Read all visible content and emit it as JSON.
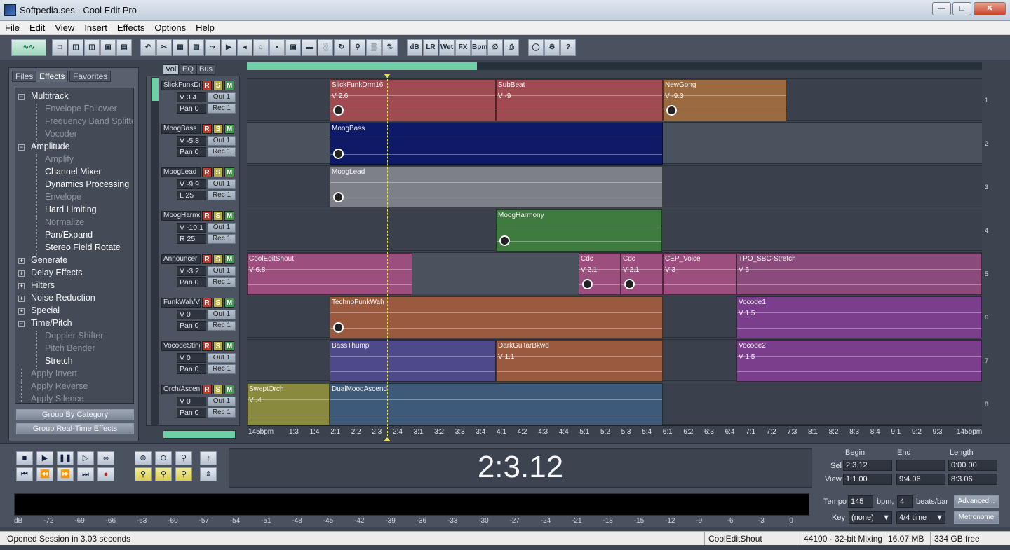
{
  "window": {
    "title": "Softpedia.ses - Cool Edit Pro"
  },
  "menu": [
    "File",
    "Edit",
    "View",
    "Insert",
    "Effects",
    "Options",
    "Help"
  ],
  "left_panel": {
    "tabs": [
      "Files",
      "Effects",
      "Favorites"
    ],
    "active_tab": "Effects",
    "tree": [
      {
        "label": "Multitrack",
        "type": "group",
        "expanded": true
      },
      {
        "label": "Envelope Follower",
        "type": "item",
        "enabled": false
      },
      {
        "label": "Frequency Band Splitter",
        "type": "item",
        "enabled": false
      },
      {
        "label": "Vocoder",
        "type": "item",
        "enabled": false
      },
      {
        "label": "Amplitude",
        "type": "group",
        "expanded": true
      },
      {
        "label": "Amplify",
        "type": "item",
        "enabled": false
      },
      {
        "label": "Channel Mixer",
        "type": "item",
        "enabled": true
      },
      {
        "label": "Dynamics Processing",
        "type": "item",
        "enabled": true
      },
      {
        "label": "Envelope",
        "type": "item",
        "enabled": false
      },
      {
        "label": "Hard Limiting",
        "type": "item",
        "enabled": true
      },
      {
        "label": "Normalize",
        "type": "item",
        "enabled": false
      },
      {
        "label": "Pan/Expand",
        "type": "item",
        "enabled": true
      },
      {
        "label": "Stereo Field Rotate",
        "type": "item",
        "enabled": true
      },
      {
        "label": "Generate",
        "type": "group",
        "expanded": false
      },
      {
        "label": "Delay Effects",
        "type": "group",
        "expanded": false
      },
      {
        "label": "Filters",
        "type": "group",
        "expanded": false
      },
      {
        "label": "Noise Reduction",
        "type": "group",
        "expanded": false
      },
      {
        "label": "Special",
        "type": "group",
        "expanded": false
      },
      {
        "label": "Time/Pitch",
        "type": "group",
        "expanded": true
      },
      {
        "label": "Doppler Shifter",
        "type": "item",
        "enabled": false
      },
      {
        "label": "Pitch Bender",
        "type": "item",
        "enabled": false
      },
      {
        "label": "Stretch",
        "type": "item",
        "enabled": true
      },
      {
        "label": "Apply Invert",
        "type": "root",
        "enabled": false
      },
      {
        "label": "Apply Reverse",
        "type": "root",
        "enabled": false
      },
      {
        "label": "Apply Silence",
        "type": "root",
        "enabled": false
      }
    ],
    "buttons": [
      "Group By Category",
      "Group Real-Time Effects"
    ]
  },
  "track_tabs": [
    "Vol",
    "EQ",
    "Bus"
  ],
  "tracks": [
    {
      "name": "SlickFunkDr",
      "vol": "V 3.4",
      "pan": "Pan 0",
      "out": "Out 1",
      "rec": "Rec 1"
    },
    {
      "name": "MoogBass",
      "vol": "V -5.8",
      "pan": "Pan 0",
      "out": "Out 1",
      "rec": "Rec 1"
    },
    {
      "name": "MoogLead",
      "vol": "V -9.9",
      "pan": "L  25",
      "out": "Out 1",
      "rec": "Rec 1"
    },
    {
      "name": "MoogHarmo",
      "vol": "V -10.1",
      "pan": "R  25",
      "out": "Out 1",
      "rec": "Rec 1"
    },
    {
      "name": "Announcer",
      "vol": "V -3.2",
      "pan": "Pan 0",
      "out": "Out 1",
      "rec": "Rec 1"
    },
    {
      "name": "FunkWah/Vc",
      "vol": "V 0",
      "pan": "Pan 0",
      "out": "Out 1",
      "rec": "Rec 1"
    },
    {
      "name": "VocodeSting",
      "vol": "V 0",
      "pan": "Pan 0",
      "out": "Out 1",
      "rec": "Rec 1"
    },
    {
      "name": "Orch/Ascend",
      "vol": "V 0",
      "pan": "Pan 0",
      "out": "Out 1",
      "rec": "Rec 1"
    }
  ],
  "rsm": [
    "R",
    "S",
    "M"
  ],
  "track_numbers": [
    "1",
    "2",
    "3",
    "4",
    "5",
    "6",
    "7",
    "8"
  ],
  "clips": [
    {
      "lane": 0,
      "name": "SlickFunkDrm16",
      "vol": "V 2.6",
      "color": "#a04a52"
    },
    {
      "lane": 0,
      "name": "SubBeat",
      "vol": "V -9",
      "color": "#a04a52"
    },
    {
      "lane": 0,
      "name": "NewGong",
      "vol": "V -9.3",
      "color": "#9c6a40"
    },
    {
      "lane": 1,
      "name": "MoogBass",
      "vol": "",
      "color": "#0e1a66"
    },
    {
      "lane": 2,
      "name": "MoogLead",
      "vol": "",
      "color": "#7d8088"
    },
    {
      "lane": 3,
      "name": "MoogHarmony",
      "vol": "",
      "color": "#3f7a3e"
    },
    {
      "lane": 4,
      "name": "CoolEditShout",
      "vol": "V 6.8",
      "color": "#9c4f7e"
    },
    {
      "lane": 4,
      "name": "Cdc",
      "vol": "V 2.1",
      "color": "#9c4f7e"
    },
    {
      "lane": 4,
      "name": "Cdc",
      "vol": "V 2.1",
      "color": "#9c4f7e"
    },
    {
      "lane": 4,
      "name": "CEP_Voice",
      "vol": "V 3",
      "color": "#9c4f7e"
    },
    {
      "lane": 4,
      "name": "TPO_SBC-Stretch",
      "vol": "V 6",
      "color": "#8a4a7a"
    },
    {
      "lane": 5,
      "name": "TechnoFunkWah",
      "vol": "",
      "color": "#9a5a40"
    },
    {
      "lane": 5,
      "name": "Vocode1",
      "vol": "V 1.5",
      "color": "#7a3e8c"
    },
    {
      "lane": 6,
      "name": "BassThump",
      "vol": "",
      "color": "#4e4a8a"
    },
    {
      "lane": 6,
      "name": "DarkGuitarBkwd",
      "vol": "V 1.1",
      "color": "#9a5a40"
    },
    {
      "lane": 6,
      "name": "Vocode2",
      "vol": "V 1.5",
      "color": "#7a3e8c"
    },
    {
      "lane": 7,
      "name": "SweptOrch",
      "vol": "V .4",
      "color": "#8a8a3e"
    },
    {
      "lane": 7,
      "name": "DualMoogAscend",
      "vol": "",
      "color": "#3e5a7a"
    }
  ],
  "ruler": [
    "145bpm",
    "1:3",
    "1:4",
    "2:1",
    "2:2",
    "2:3",
    "2:4",
    "3:1",
    "3:2",
    "3:3",
    "3:4",
    "4:1",
    "4:2",
    "4:3",
    "4:4",
    "5:1",
    "5:2",
    "5:3",
    "5:4",
    "6:1",
    "6:2",
    "6:3",
    "6:4",
    "7:1",
    "7:2",
    "7:3",
    "8:1",
    "8:2",
    "8:3",
    "8:4",
    "9:1",
    "9:2",
    "9:3",
    "145bpm"
  ],
  "transport": {
    "time": "2:3.12"
  },
  "selection": {
    "headers": [
      "Begin",
      "End",
      "Length"
    ],
    "sel_label": "Sel",
    "view_label": "View",
    "sel": [
      "2:3.12",
      "",
      "0:00.00"
    ],
    "view": [
      "1:1.00",
      "9:4.06",
      "8:3.06"
    ]
  },
  "meter_scale": [
    "dB",
    "-72",
    "-69",
    "-66",
    "-63",
    "-60",
    "-57",
    "-54",
    "-51",
    "-48",
    "-45",
    "-42",
    "-39",
    "-36",
    "-33",
    "-30",
    "-27",
    "-24",
    "-21",
    "-18",
    "-15",
    "-12",
    "-9",
    "-6",
    "-3",
    "0"
  ],
  "tempo": {
    "tempo_label": "Tempo",
    "tempo": "145",
    "bpm_label": "bpm,",
    "beats": "4",
    "beats_label": "beats/bar",
    "key_label": "Key",
    "key": "(none)",
    "time_sig": "4/4 time",
    "advanced": "Advanced...",
    "metronome": "Metronome"
  },
  "status": {
    "message": "Opened Session in 3.03 seconds",
    "clip": "CoolEditShout",
    "format": "44100 · 32-bit Mixing",
    "mem": "16.07 MB",
    "disk": "334 GB free"
  }
}
